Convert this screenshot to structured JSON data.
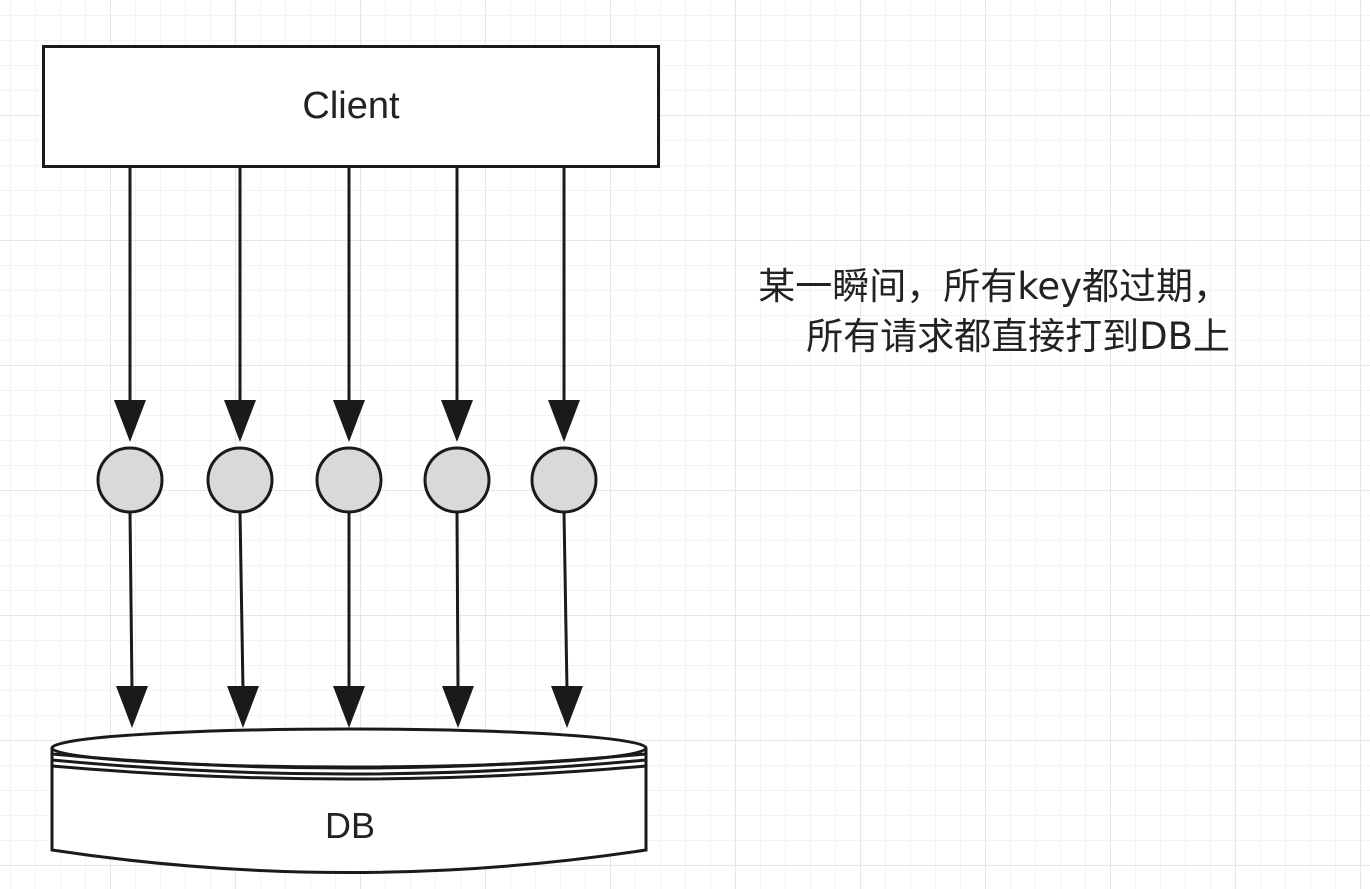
{
  "client": {
    "label": "Client"
  },
  "database": {
    "label": "DB"
  },
  "annotation": {
    "lines": [
      "某一瞬间，所有key都过期，",
      "所有请求都直接打到DB上"
    ]
  },
  "requests": 5,
  "colors": {
    "stroke": "#1a1a1a",
    "node_fill": "#d9d9d9",
    "grid": "#e6e6e6"
  }
}
